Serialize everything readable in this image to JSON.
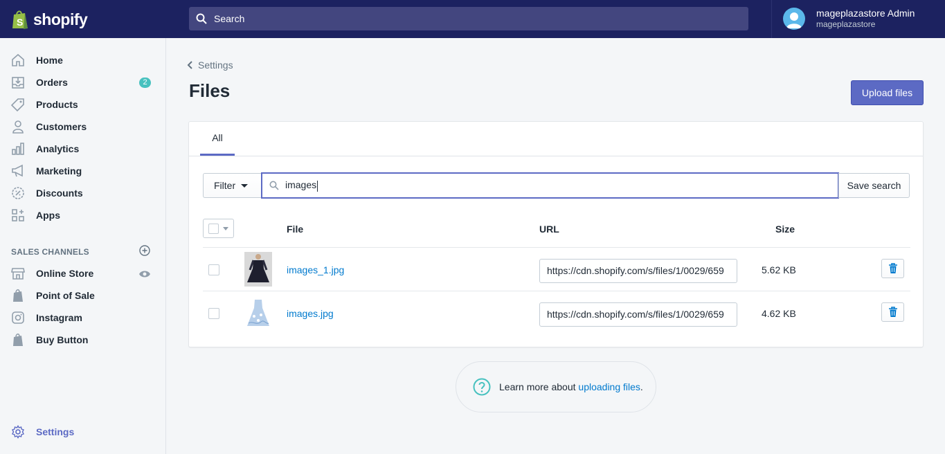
{
  "topbar": {
    "logo_text": "shopify",
    "search_placeholder": "Search",
    "user_name": "mageplazastore Admin",
    "user_store": "mageplazastore"
  },
  "sidebar": {
    "items": [
      {
        "label": "Home",
        "icon": "home-icon"
      },
      {
        "label": "Orders",
        "icon": "orders-icon",
        "badge": "2"
      },
      {
        "label": "Products",
        "icon": "tag-icon"
      },
      {
        "label": "Customers",
        "icon": "person-icon"
      },
      {
        "label": "Analytics",
        "icon": "bar-chart-icon"
      },
      {
        "label": "Marketing",
        "icon": "megaphone-icon"
      },
      {
        "label": "Discounts",
        "icon": "discount-icon"
      },
      {
        "label": "Apps",
        "icon": "apps-icon"
      }
    ],
    "sales_channels_title": "SALES CHANNELS",
    "channels": [
      {
        "label": "Online Store",
        "icon": "store-icon"
      },
      {
        "label": "Point of Sale",
        "icon": "shopping-bag-icon"
      },
      {
        "label": "Instagram",
        "icon": "instagram-icon"
      },
      {
        "label": "Buy Button",
        "icon": "shopping-bag-icon"
      }
    ],
    "settings_label": "Settings"
  },
  "page": {
    "breadcrumb": "Settings",
    "title": "Files",
    "upload_button": "Upload files",
    "tab": "All",
    "filter_label": "Filter",
    "search_value": "images",
    "save_search": "Save search",
    "columns": {
      "file": "File",
      "url": "URL",
      "size": "Size"
    },
    "files": [
      {
        "name": "images_1.jpg",
        "url": "https://cdn.shopify.com/s/files/1/0029/659",
        "size": "5.62 KB"
      },
      {
        "name": "images.jpg",
        "url": "https://cdn.shopify.com/s/files/1/0029/659",
        "size": "4.62 KB"
      }
    ],
    "help_prefix": "Learn more about ",
    "help_link": "uploading files",
    "help_suffix": "."
  },
  "colors": {
    "topbar": "#1c2260",
    "accent": "#5c6ac4",
    "link": "#007ace",
    "badge": "#47c1bf"
  }
}
